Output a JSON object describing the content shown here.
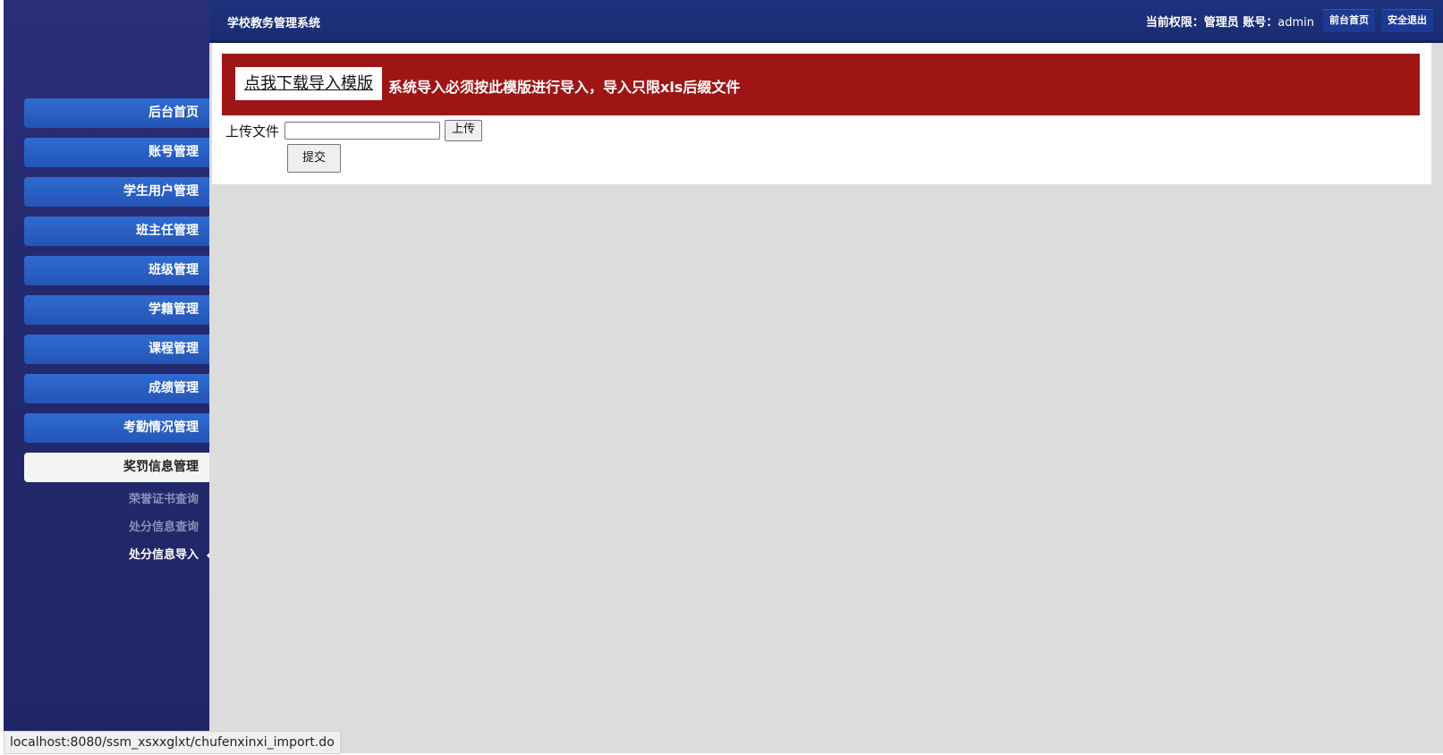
{
  "app": {
    "title": "学校教务管理系统"
  },
  "header": {
    "user_info_prefix": "当前权限：管理员 账号：",
    "username": "admin",
    "front_home_label": "前台首页",
    "logout_label": "安全退出"
  },
  "sidebar": {
    "items": [
      {
        "label": "后台首页"
      },
      {
        "label": "账号管理"
      },
      {
        "label": "学生用户管理"
      },
      {
        "label": "班主任管理"
      },
      {
        "label": "班级管理"
      },
      {
        "label": "学籍管理"
      },
      {
        "label": "课程管理"
      },
      {
        "label": "成绩管理"
      },
      {
        "label": "考勤情况管理"
      },
      {
        "label": "奖罚信息管理"
      }
    ],
    "subitems": [
      {
        "label": "荣誉证书查询"
      },
      {
        "label": "处分信息查询"
      },
      {
        "label": "处分信息导入"
      }
    ]
  },
  "main": {
    "download_label": "点我下载导入模版",
    "notice_text": "系统导入必须按此模版进行导入，导入只限xls后缀文件",
    "upload_label": "上传文件",
    "file_value": "",
    "upload_button": "上传",
    "submit_button": "提交"
  },
  "status_bar": {
    "url": "localhost:8080/ssm_xsxxglxt/chufenxinxi_import.do"
  },
  "colors": {
    "sidebar_bg": "#2b2f7a",
    "topbar_bg": "#1e327e",
    "menu_item": "#2f6bd1",
    "notice_bg": "#9e1515",
    "content_bg": "#dcdcdc"
  }
}
